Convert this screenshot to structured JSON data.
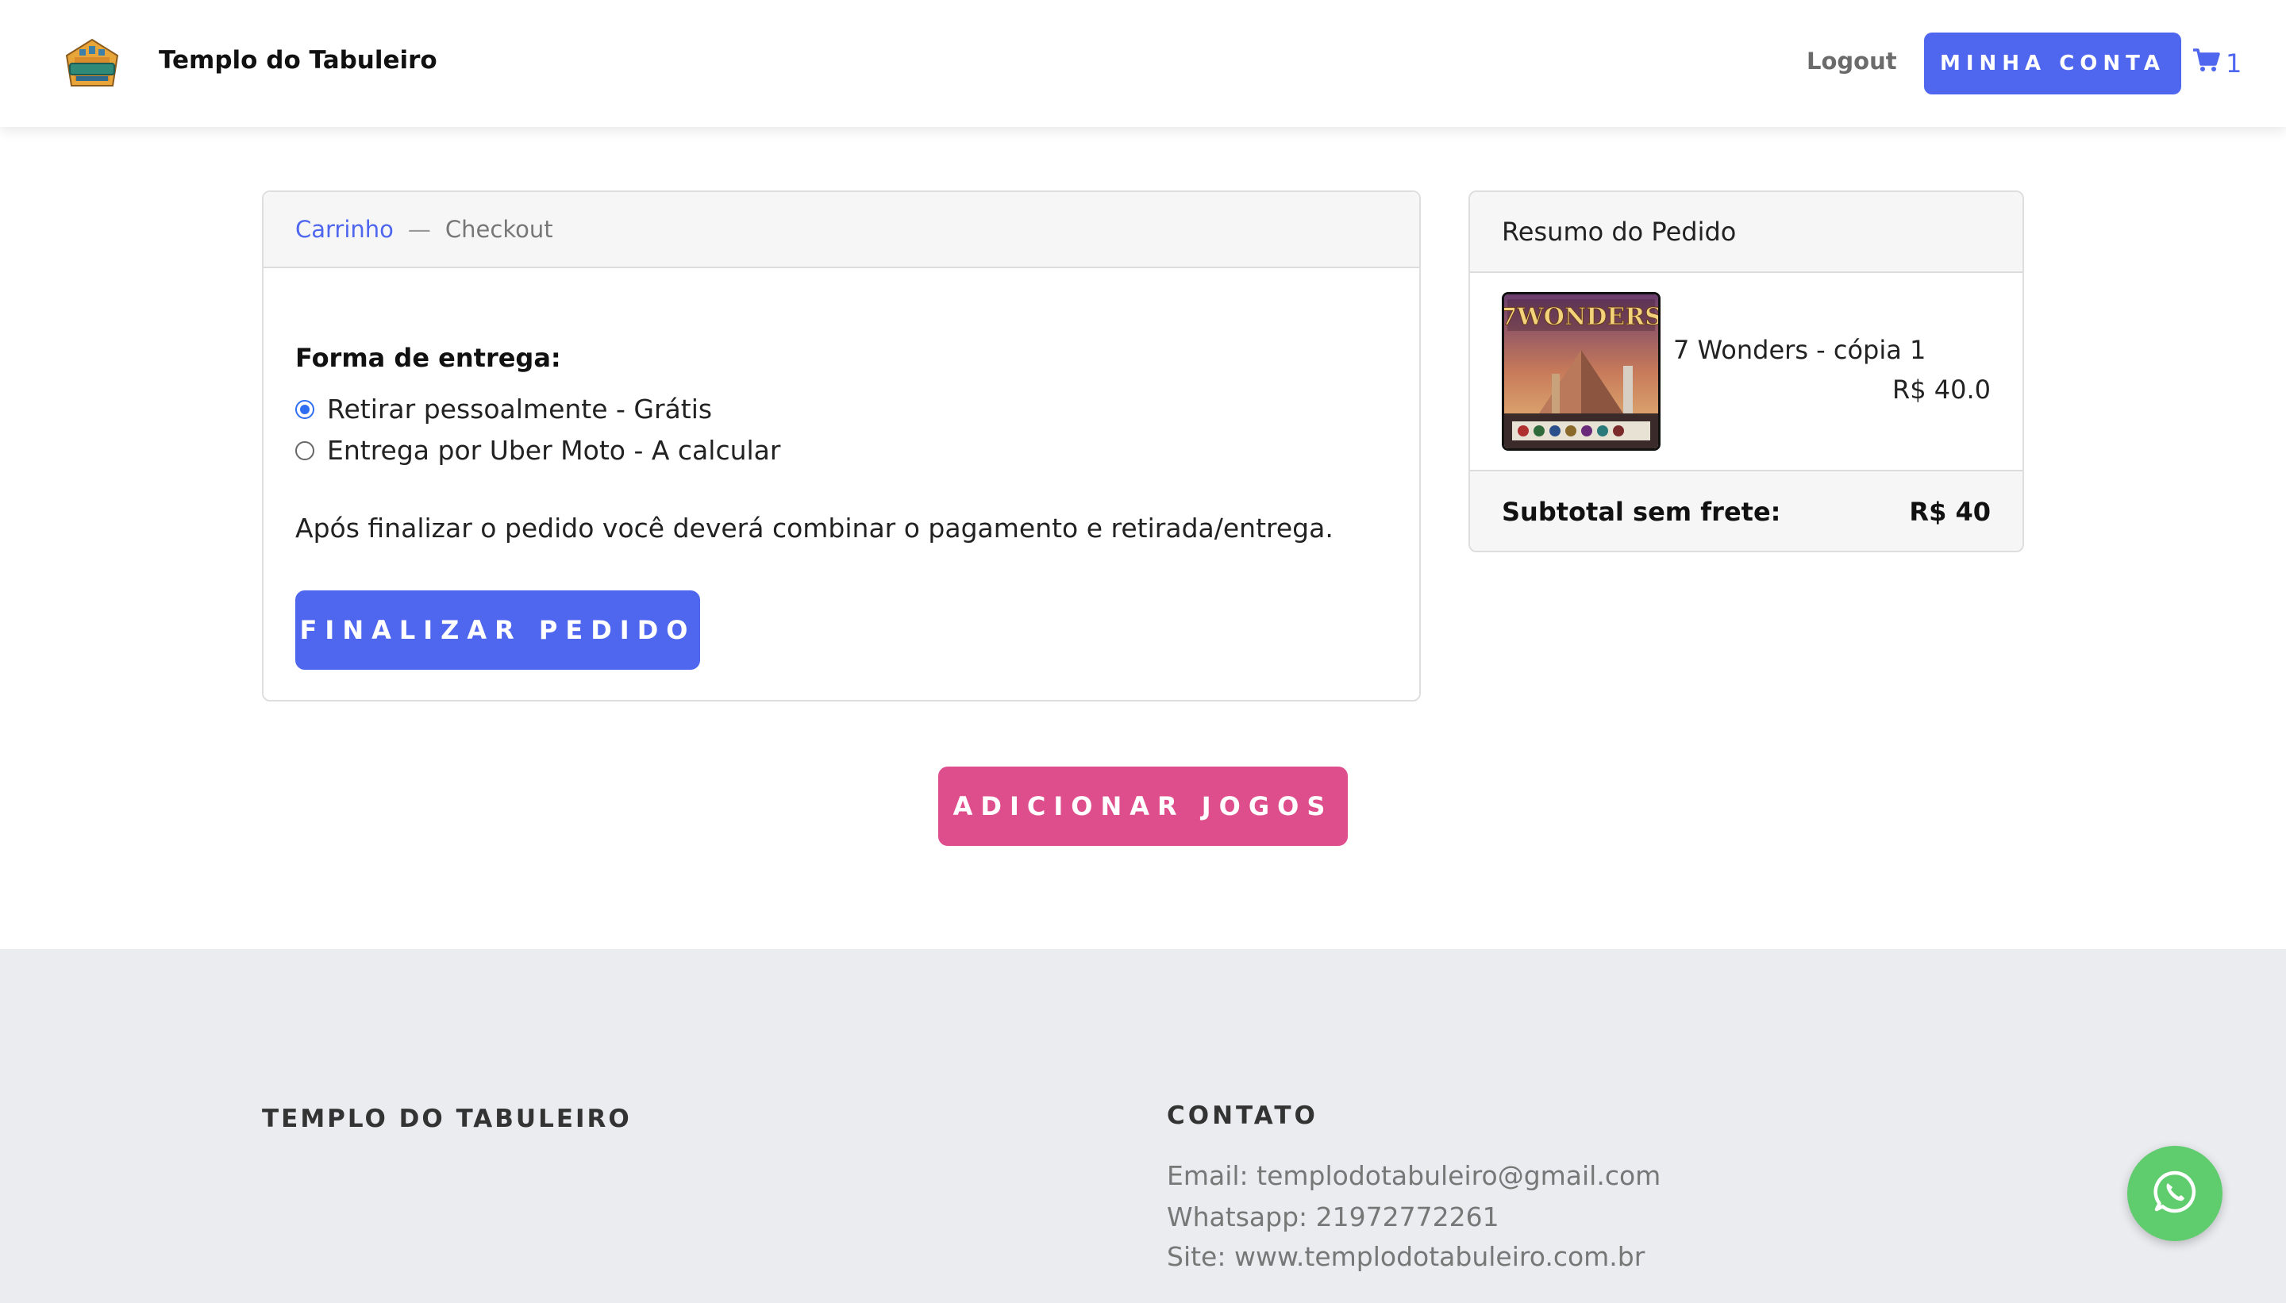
{
  "header": {
    "brand_name": "Templo do Tabuleiro",
    "logout_label": "Logout",
    "account_button_label": "MINHA CONTA",
    "cart_count": "1"
  },
  "breadcrumb": {
    "cart_label": "Carrinho",
    "separator": "—",
    "current_label": "Checkout"
  },
  "checkout": {
    "delivery_title": "Forma de entrega:",
    "options": [
      {
        "label": "Retirar pessoalmente - Grátis",
        "selected": true
      },
      {
        "label": "Entrega por Uber Moto - A calcular",
        "selected": false
      }
    ],
    "info_text": "Após finalizar o pedido você deverá combinar o pagamento e retirada/entrega.",
    "finalize_label": "FINALIZAR PEDIDO"
  },
  "summary": {
    "title": "Resumo do Pedido",
    "items": [
      {
        "name": "7 Wonders - cópia 1",
        "price": "R$ 40.0",
        "thumb_text": "7WONDERS"
      }
    ],
    "subtotal_label": "Subtotal sem frete:",
    "subtotal_value": "R$ 40"
  },
  "add_games_label": "ADICIONAR JOGOS",
  "footer": {
    "brand": "TEMPLO DO TABULEIRO",
    "contact_title": "CONTATO",
    "email": "Email: templodotabuleiro@gmail.com",
    "whatsapp": "Whatsapp: 21972772261",
    "site": "Site: www.templodotabuleiro.com.br"
  },
  "icons": {
    "logo": "templo-do-tabuleiro-logo",
    "cart": "shopping-cart-icon",
    "whatsapp": "whatsapp-icon"
  },
  "colors": {
    "primary": "#4f66ef",
    "accent": "#df4e8c",
    "footer_bg": "#ebecf0",
    "whatsapp": "#5fcc6e"
  }
}
